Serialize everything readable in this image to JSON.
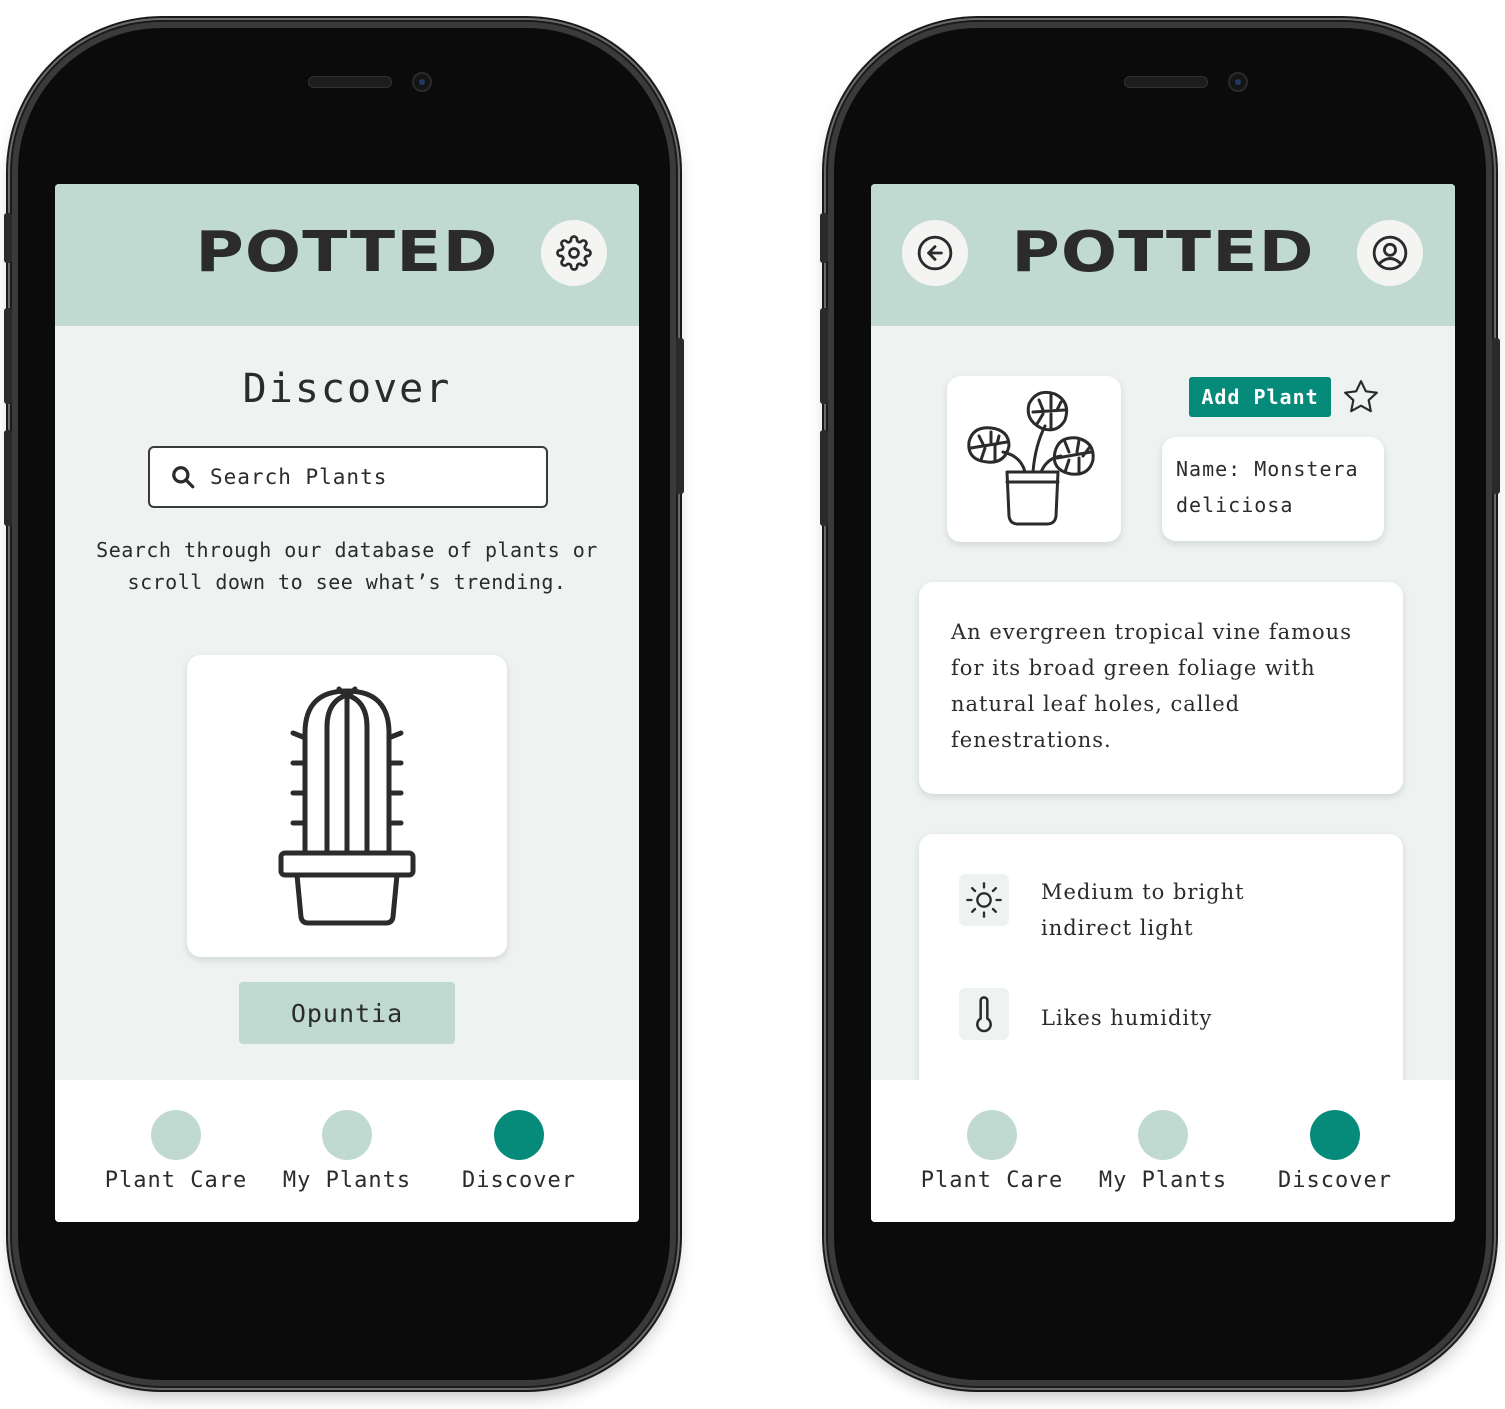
{
  "app": {
    "logo": "POTTED"
  },
  "left_screen": {
    "page_title": "Discover",
    "search": {
      "placeholder": "Search Plants",
      "icon": "search-icon"
    },
    "description": "Search through our database of plants or scroll down to see what’s trending.",
    "featured_plant": {
      "icon": "cactus-icon",
      "name": "Opuntia"
    },
    "header_button_icon": "gear-icon"
  },
  "right_screen": {
    "back_icon": "arrow-left-icon",
    "profile_icon": "user-circle-icon",
    "plant_icon": "monstera-icon",
    "add_plant_label": "Add Plant",
    "favorite_icon": "star-icon",
    "name_label": "Name: Monstera deliciosa",
    "description": "An evergreen tropical vine famous for its broad green foliage with natural leaf holes, called fenestrations.",
    "care": [
      {
        "icon": "sun-icon",
        "text": "Medium to bright indirect light"
      },
      {
        "icon": "thermometer-icon",
        "text": "Likes humidity"
      }
    ]
  },
  "nav": {
    "items": [
      {
        "label": "Plant Care",
        "active": false
      },
      {
        "label": "My Plants",
        "active": false
      },
      {
        "label": "Discover",
        "active": true
      }
    ]
  },
  "colors": {
    "header": "#c1dad1",
    "accent": "#068a7a",
    "background": "#eef3f1"
  }
}
